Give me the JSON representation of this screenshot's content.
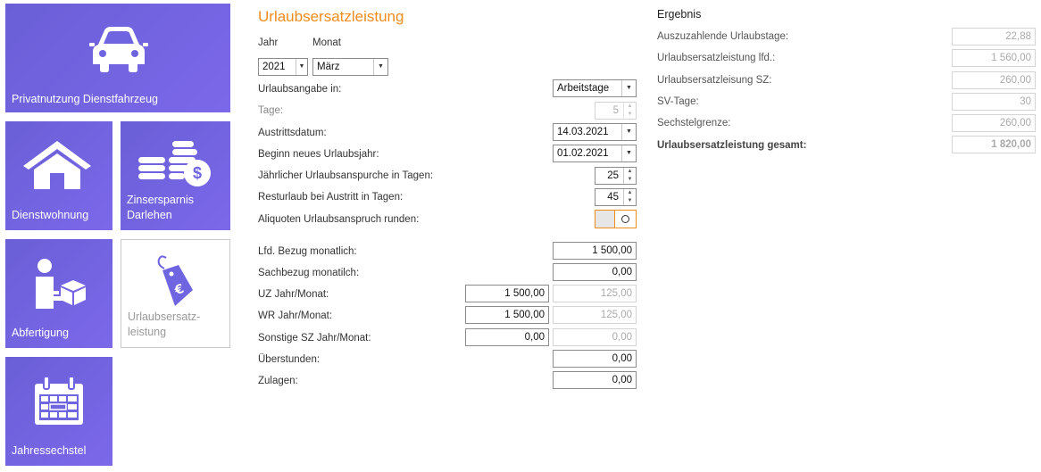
{
  "tiles": {
    "privatnutzung": "Privatnutzung Dienstfahrzeug",
    "dienstwohnung": "Dienstwohnung",
    "zinsersparnis_1": "Zinsersparnis",
    "zinsersparnis_2": "Darlehen",
    "abfertigung": "Abfertigung",
    "urlaub_1": "Urlaubsersatz-",
    "urlaub_2": "leistung",
    "jahressechstel": "Jahressechstel"
  },
  "form": {
    "title": "Urlaubsersatzleistung",
    "jahr_label": "Jahr",
    "monat_label": "Monat",
    "jahr_value": "2021",
    "monat_value": "März",
    "urlaubsangabe_label": "Urlaubsangabe in:",
    "urlaubsangabe_value": "Arbeitstage",
    "tage_label": "Tage:",
    "tage_value": "5",
    "austritt_label": "Austrittsdatum:",
    "austritt_value": "14.03.2021",
    "beginn_label": "Beginn neues Urlaubsjahr:",
    "beginn_value": "01.02.2021",
    "jaehrlich_label": "Jährlicher Urlaubsanspurche in Tagen:",
    "jaehrlich_value": "25",
    "rest_label": "Resturlaub bei Austritt in Tagen:",
    "rest_value": "45",
    "aliquot_label": "Aliquoten Urlaubsanspruch runden:",
    "lfd_label": "Lfd. Bezug monatlich:",
    "lfd_value": "1 500,00",
    "sach_label": "Sachbezug monatilch:",
    "sach_value": "0,00",
    "uz_label": "UZ Jahr/Monat:",
    "uz_jahr": "1 500,00",
    "uz_monat": "125,00",
    "wr_label": "WR Jahr/Monat:",
    "wr_jahr": "1 500,00",
    "wr_monat": "125,00",
    "sonst_label": "Sonstige SZ Jahr/Monat:",
    "sonst_jahr": "0,00",
    "sonst_monat": "0,00",
    "ueber_label": "Überstunden:",
    "ueber_value": "0,00",
    "zulagen_label": "Zulagen:",
    "zulagen_value": "0,00"
  },
  "result": {
    "title": "Ergebnis",
    "rows": [
      {
        "label": "Auszuzahlende Urlaubstage:",
        "value": "22,88"
      },
      {
        "label": "Urlaubsersatzleistung lfd.:",
        "value": "1 560,00"
      },
      {
        "label": "Urlaubsersatzleisung SZ:",
        "value": "260,00"
      },
      {
        "label": "SV-Tage:",
        "value": "30"
      },
      {
        "label": "Sechstelgrenze:",
        "value": "260,00"
      },
      {
        "label": "Urlaubsersatzleistung gesamt:",
        "value": "1 820,00"
      }
    ]
  },
  "colors": {
    "accent": "#ee8c1c",
    "tile": "#7065e0"
  }
}
